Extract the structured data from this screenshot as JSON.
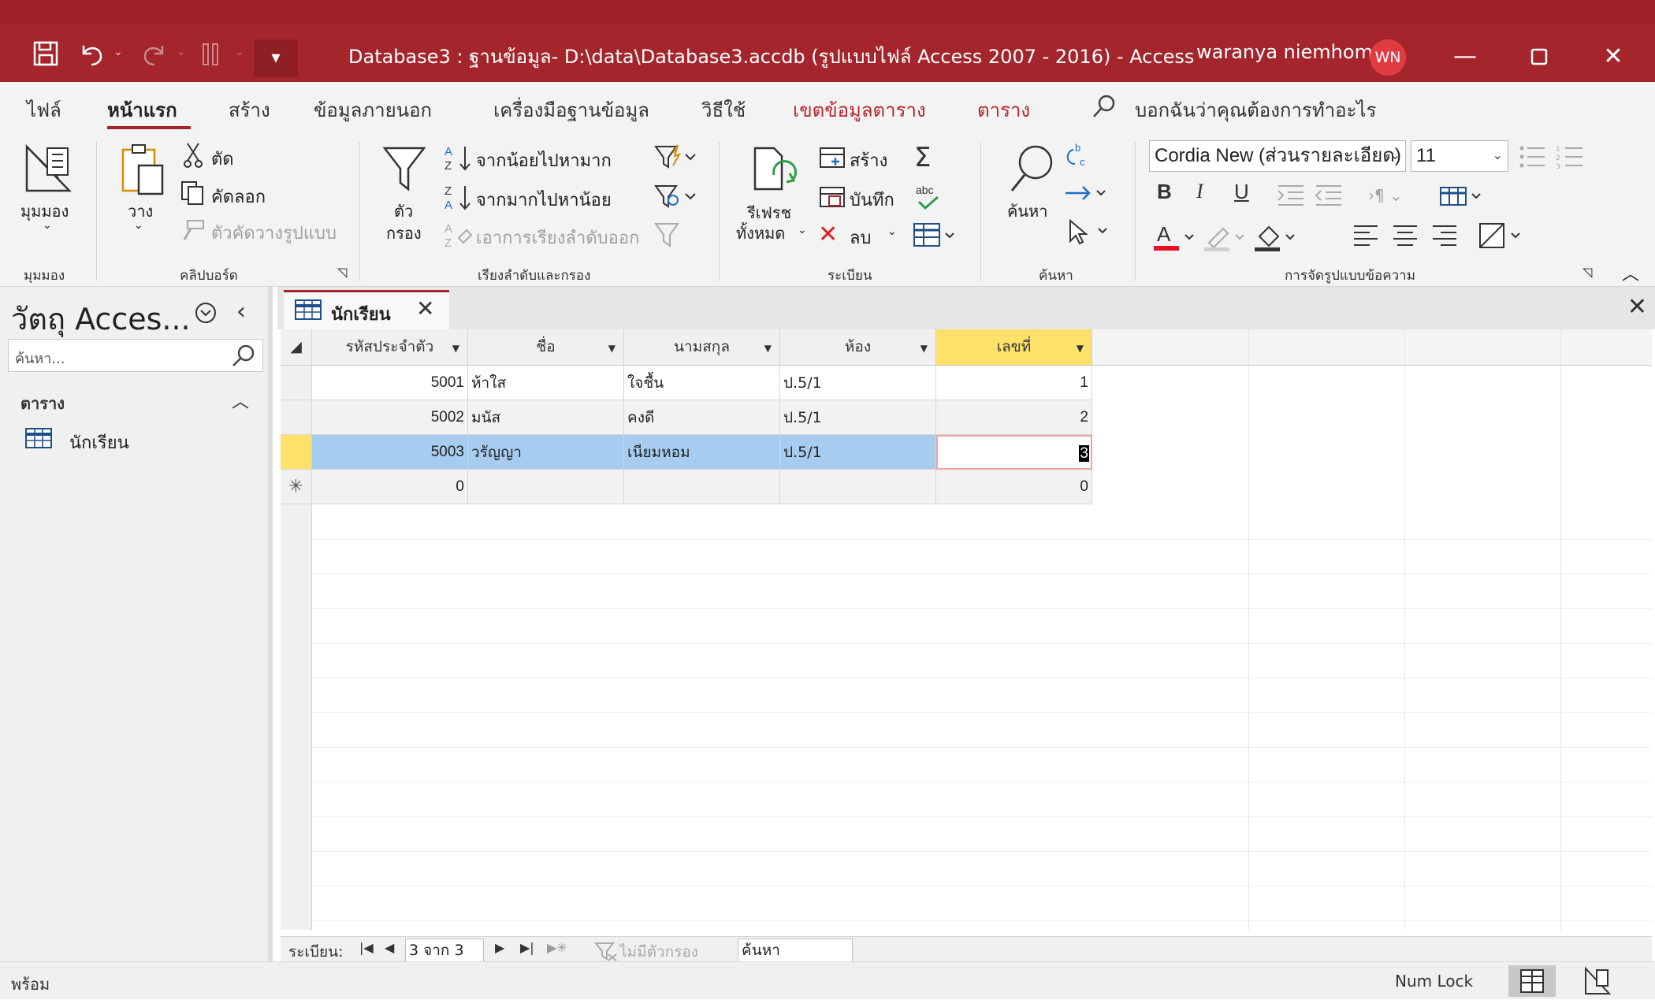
{
  "window": {
    "title": "Database3 : ฐานข้อมูล- D:\\data\\Database3.accdb (รูปแบบไฟล์ Access 2007 - 2016)  -  Access",
    "user_name": "waranya niemhom",
    "user_initials": "WN"
  },
  "ribbon_tabs": [
    "ไฟล์",
    "หน้าแรก",
    "สร้าง",
    "ข้อมูลภายนอก",
    "เครื่องมือฐานข้อมูล",
    "วิธีใช้",
    "เขตข้อมูลตาราง",
    "ตาราง"
  ],
  "tell_me": "บอกฉันว่าคุณต้องการทำอะไร",
  "ribbon": {
    "views": {
      "label": "มุมมอง",
      "group": "มุมมอง"
    },
    "clipboard": {
      "paste": "วาง",
      "cut": "ตัด",
      "copy": "คัดลอก",
      "format_painter": "ตัวคัดวางรูปแบบ",
      "group": "คลิปบอร์ด"
    },
    "sort_filter": {
      "filter_line1": "ตัว",
      "filter_line2": "กรอง",
      "ascending": "จากน้อยไปหามาก",
      "descending": "จากมากไปหาน้อย",
      "remove_sort": "เอาการเรียงลำดับออก",
      "group": "เรียงลำดับและกรอง"
    },
    "records": {
      "refresh_line1": "รีเฟรช",
      "refresh_line2": "ทั้งหมด",
      "new": "สร้าง",
      "save": "บันทึก",
      "delete": "ลบ",
      "group": "ระเบียน"
    },
    "find": {
      "find": "ค้นหา",
      "group": "ค้นหา"
    },
    "text_formatting": {
      "font": "Cordia New (ส่วนรายละเอียด)",
      "size": "11",
      "bold": "B",
      "italic": "I",
      "underline": "U",
      "group": "การจัดรูปแบบข้อความ"
    }
  },
  "nav_pane": {
    "title": "วัตถุ Acces...",
    "search_placeholder": "ค้นหา...",
    "section": "ตาราง",
    "items": [
      "นักเรียน"
    ]
  },
  "document": {
    "tab_label": "นักเรียน",
    "columns": [
      "รหัสประจำตัว",
      "ชื่อ",
      "นามสกุล",
      "ห้อง",
      "เลขที่"
    ],
    "rows": [
      [
        "5001",
        "ห้าใส",
        "ใจชื้น",
        "ป.5/1",
        "1"
      ],
      [
        "5002",
        "มนัส",
        "คงดี",
        "ป.5/1",
        "2"
      ],
      [
        "5003",
        "วรัญญา",
        "เนียมหอม",
        "ป.5/1",
        "3"
      ]
    ],
    "new_row": [
      "0",
      "",
      "",
      "",
      "0"
    ],
    "new_row_marker": "✳"
  },
  "record_nav": {
    "label": "ระเบียน:",
    "position": "3 จาก 3",
    "filter": "ไม่มีตัวกรอง",
    "search": "ค้นหา"
  },
  "status": {
    "ready": "พร้อม",
    "num_lock": "Num Lock"
  }
}
